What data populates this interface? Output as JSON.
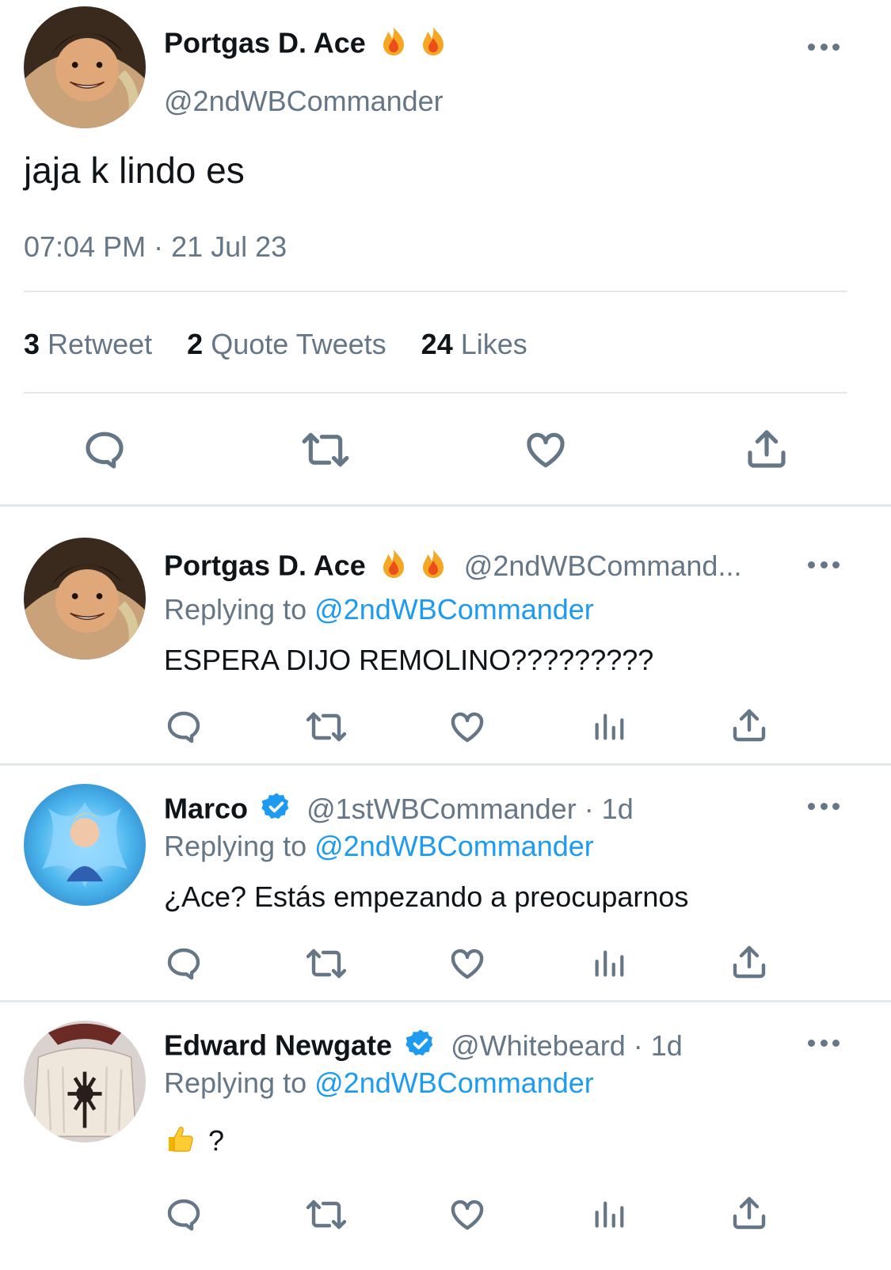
{
  "main_tweet": {
    "author_name": "Portgas D. Ace",
    "author_handle": "@2ndWBCommander",
    "text": "jaja k lindo es",
    "timestamp": "07:04 PM · 21 Jul 23",
    "stats": {
      "retweets_count": "3",
      "retweets_label": "Retweet",
      "quotes_count": "2",
      "quotes_label": "Quote Tweets",
      "likes_count": "24",
      "likes_label": "Likes"
    }
  },
  "replies": [
    {
      "author_name": "Portgas D. Ace",
      "author_handle": "@2ndWBCommand...",
      "time": "",
      "replying_prefix": "Replying to",
      "replying_handle": "@2ndWBCommander",
      "text": "ESPERA DIJO REMOLINO?????????"
    },
    {
      "author_name": "Marco",
      "author_handle": "@1stWBCommander · 1d",
      "verified": true,
      "replying_prefix": "Replying to",
      "replying_handle": "@2ndWBCommander",
      "text": "¿Ace? Estás empezando a preocuparnos"
    },
    {
      "author_name": "Edward Newgate",
      "author_handle": "@Whitebeard · 1d",
      "verified": true,
      "replying_prefix": "Replying to",
      "replying_handle": "@2ndWBCommander",
      "text": "?"
    }
  ],
  "icons": {
    "name_emoji": "fire-emoji",
    "reply_emoji": "thumbs-up-emoji",
    "actions": [
      "reply-icon",
      "retweet-icon",
      "like-icon",
      "share-icon"
    ],
    "reply_actions": [
      "reply-icon",
      "retweet-icon",
      "like-icon",
      "analytics-icon",
      "share-icon"
    ]
  },
  "colors": {
    "text": "#0f1419",
    "muted": "#657786",
    "link": "#1d9bf0",
    "divider": "#e1e8ed",
    "verified": "#1d9bf0"
  }
}
